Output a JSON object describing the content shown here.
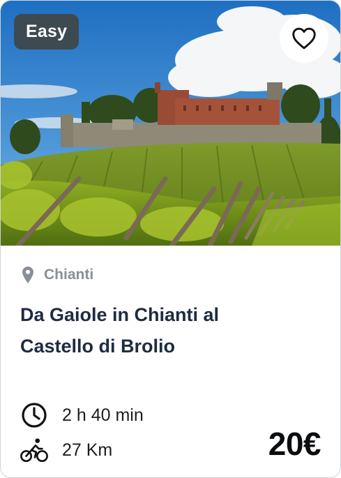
{
  "card": {
    "difficulty_badge": "Easy",
    "favorite_icon": "heart-outline-icon",
    "location_icon": "map-pin-icon",
    "location": "Chianti",
    "title_line1": "Da Gaiole in Chianti al",
    "title_line2": "Castello di Brolio",
    "duration_icon": "clock-icon",
    "duration": "2 h 40 min",
    "distance_icon": "bicycle-icon",
    "distance": "27 Km",
    "price": "20€"
  },
  "colors": {
    "badge_bg": "#3d4a52",
    "title": "#1f2b40",
    "location_text": "#8a8f97",
    "price": "#0b0d10"
  }
}
